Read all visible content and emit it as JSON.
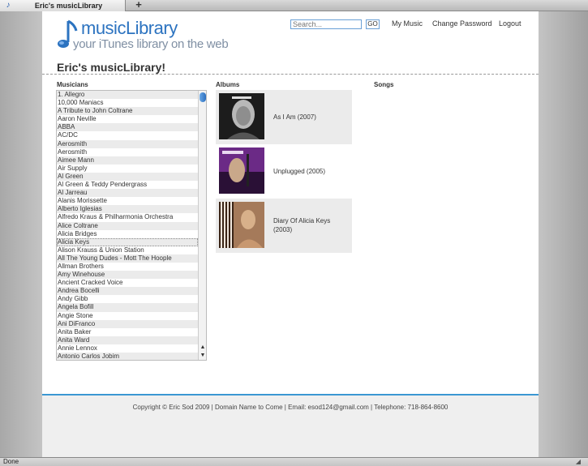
{
  "browser": {
    "tab_title": "Eric's musicLibrary",
    "new_tab_label": "+",
    "status_text": "Done"
  },
  "header": {
    "logo_title": "musicLibrary",
    "logo_tagline": "your iTunes library on the web",
    "search_placeholder": "Search...",
    "search_button": "GO",
    "nav": {
      "my_music": "My Music",
      "change_password": "Change Password",
      "logout": "Logout"
    }
  },
  "page_title": "Eric's musicLibrary!",
  "columns": {
    "musicians": "Musicians",
    "albums": "Albums",
    "songs": "Songs"
  },
  "musicians": [
    "1. Allegro",
    "10,000 Maniacs",
    "A Tribute to John Coltrane",
    "Aaron Neville",
    "ABBA",
    "AC/DC",
    "Aerosmith",
    "Aerosmith",
    "Aimee Mann",
    "Air Supply",
    "Al Green",
    "Al Green & Teddy Pendergrass",
    "Al Jarreau",
    "Alanis Morissette",
    "Alberto Iglesias",
    "Alfredo Kraus & Philharmonia Orchestra",
    "Alice Coltrane",
    "Alicia Bridges",
    "Alicia Keys",
    "Alison Krauss & Union Station",
    "All The Young Dudes - Mott The Hoople",
    "Allman Brothers",
    "Amy Winehouse",
    "Ancient Cracked Voice",
    "Andrea Bocelli",
    "Andy Gibb",
    "Angela Bofill",
    "Angie Stone",
    "Ani DiFranco",
    "Anita Baker",
    "Anita Ward",
    "Annie Lennox",
    "Antonio Carlos Jobim"
  ],
  "selected_musician": "Alicia Keys",
  "albums": [
    {
      "title": "As I Am (2007)"
    },
    {
      "title": "Unplugged (2005)"
    },
    {
      "title": "Diary Of Alicia Keys (2003)"
    }
  ],
  "footer": {
    "text": "Copyright © Eric Sod 2009 | Domain Name to Come | Email: esod124@gmail.com | Telephone: 718-864-8600"
  },
  "colors": {
    "accent": "#2c73c0",
    "footer_rule": "#3b97d3",
    "row_shade": "#ebebeb"
  }
}
